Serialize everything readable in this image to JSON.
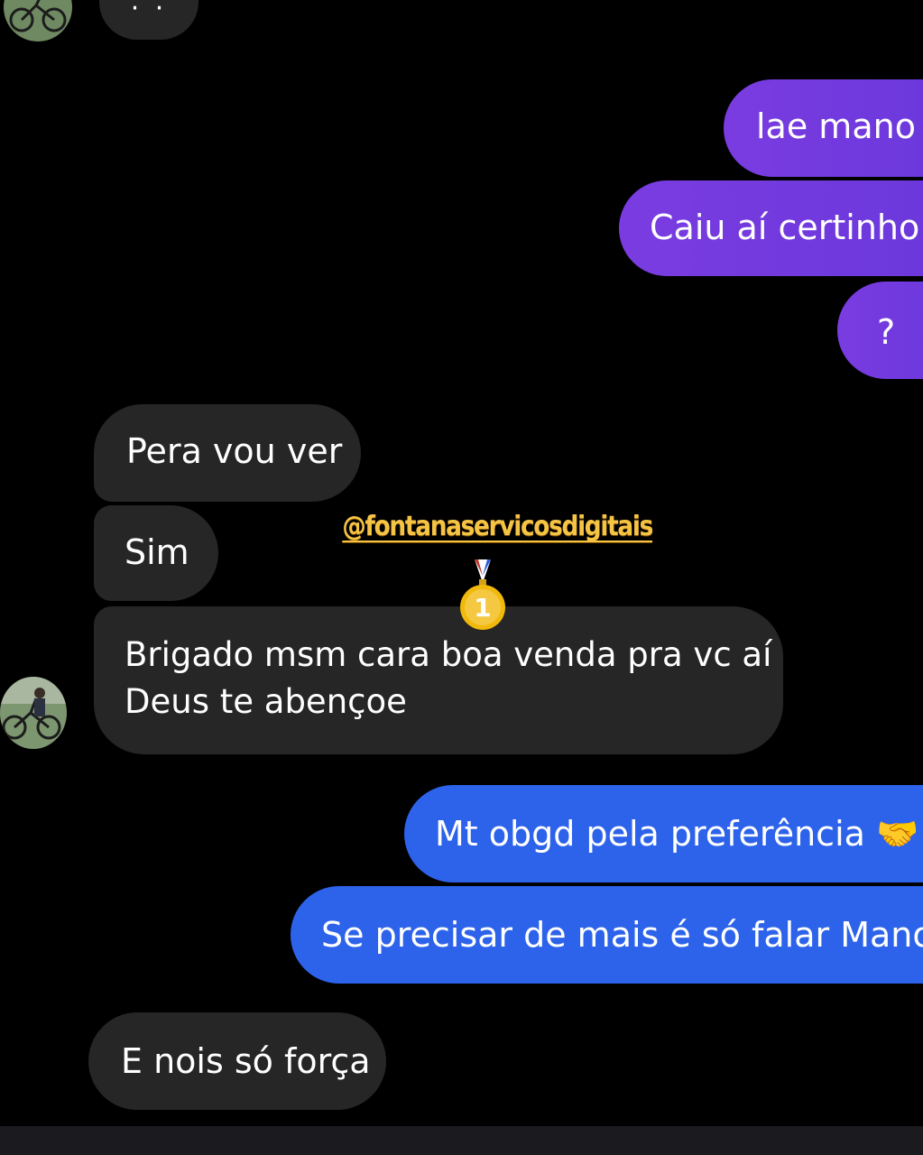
{
  "conversation": {
    "top_partial_bubble": "· ·",
    "messages": [
      {
        "id": "m1",
        "sender": "me",
        "color": "purple",
        "lines": [
          "lae mano"
        ]
      },
      {
        "id": "m2",
        "sender": "me",
        "color": "purple",
        "lines": [
          "Caiu aí certinho"
        ]
      },
      {
        "id": "m3",
        "sender": "me",
        "color": "purple",
        "lines": [
          "?"
        ]
      },
      {
        "id": "m4",
        "sender": "them",
        "lines": [
          "Pera vou ver"
        ]
      },
      {
        "id": "m5",
        "sender": "them",
        "lines": [
          "Sim"
        ]
      },
      {
        "id": "m6",
        "sender": "them",
        "lines": [
          "Brigado msm cara boa venda pra vc aí",
          "Deus te abençoe"
        ]
      },
      {
        "id": "m7",
        "sender": "me",
        "color": "blue",
        "lines": [
          "Mt obgd pela preferência 🤝"
        ]
      },
      {
        "id": "m8",
        "sender": "me",
        "color": "blue",
        "lines": [
          "Se precisar de mais é só falar Mano"
        ]
      },
      {
        "id": "m9",
        "sender": "them",
        "lines": [
          "E nois só força"
        ]
      }
    ]
  },
  "overlay": {
    "watermark_handle": "@fontanaservicosdigitais",
    "medal_icon": "first-place-medal-icon",
    "medal_number": "1"
  },
  "colors": {
    "background": "#000000",
    "received_bubble": "#262626",
    "sent_purple": "#7a3ce0",
    "sent_blue": "#2d63ea",
    "watermark": "#f6c445"
  }
}
